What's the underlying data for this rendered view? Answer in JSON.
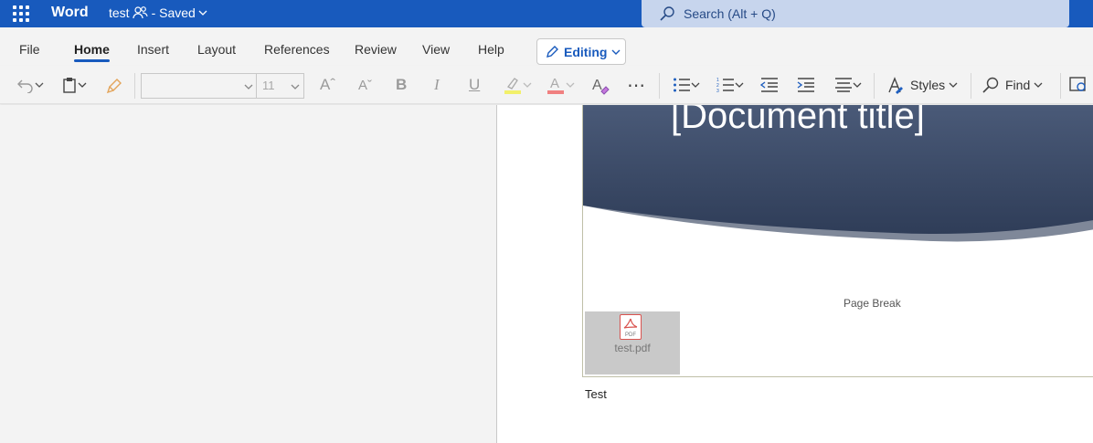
{
  "titlebar": {
    "app_name": "Word",
    "doc_name": "test",
    "status": "- Saved",
    "search_placeholder": "Search (Alt + Q)"
  },
  "ribbon": {
    "tabs": [
      "File",
      "Home",
      "Insert",
      "Layout",
      "References",
      "Review",
      "View",
      "Help"
    ],
    "active_tab": "Home",
    "mode_button": "Editing"
  },
  "toolbar": {
    "font_name": "",
    "font_size": "11",
    "styles_label": "Styles",
    "find_label": "Find"
  },
  "document": {
    "title_placeholder": "[Document title]",
    "page_break_label": "Page Break",
    "attachment_name": "test.pdf",
    "attachment_icon_text": "PDF",
    "body_text": "Test",
    "header_color": "#3a4a66"
  }
}
